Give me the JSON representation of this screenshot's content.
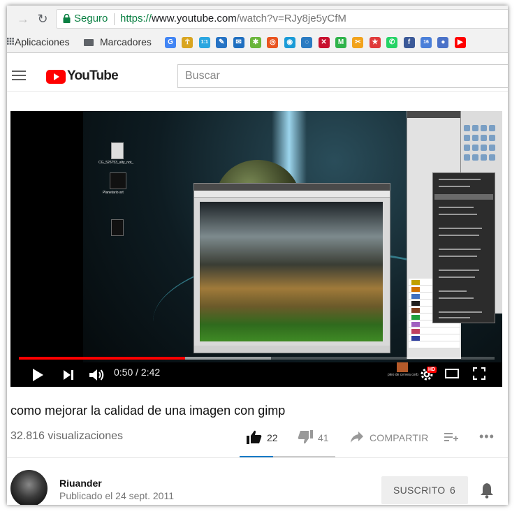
{
  "browser": {
    "secure_label": "Seguro",
    "url_scheme": "https://",
    "url_host": "www.youtube.com",
    "url_path": "/watch?v=RJy8je5yCfM",
    "bookmarks": {
      "apps_label": "Aplicaciones",
      "folder_label": "Marcadores",
      "favicons": [
        {
          "icon": "google-g-icon",
          "glyph": "G",
          "color": "#4285f4"
        },
        {
          "icon": "figure-icon",
          "glyph": "☥",
          "color": "#d9a520"
        },
        {
          "icon": "blue-news-icon",
          "glyph": "1:1",
          "color": "#2aa6e0"
        },
        {
          "icon": "blue-edit-icon",
          "glyph": "✎",
          "color": "#2673c4"
        },
        {
          "icon": "blue-chat-icon",
          "glyph": "✉",
          "color": "#1f6fc0"
        },
        {
          "icon": "green-bug-icon",
          "glyph": "✱",
          "color": "#6ab63b"
        },
        {
          "icon": "ubuntu-icon",
          "glyph": "◎",
          "color": "#e95420"
        },
        {
          "icon": "blue-circle-icon",
          "glyph": "◉",
          "color": "#1a9bd7"
        },
        {
          "icon": "blue-swirl-icon",
          "glyph": "◌",
          "color": "#2b7bc2"
        },
        {
          "icon": "red-x-icon",
          "glyph": "✕",
          "color": "#c8102e"
        },
        {
          "icon": "green-m-icon",
          "glyph": "M",
          "color": "#2fb34a"
        },
        {
          "icon": "orange-share-icon",
          "glyph": "✂",
          "color": "#f2a31c"
        },
        {
          "icon": "red-star-icon",
          "glyph": "★",
          "color": "#e03a3a"
        },
        {
          "icon": "whatsapp-icon",
          "glyph": "✆",
          "color": "#25d366"
        },
        {
          "icon": "facebook-icon",
          "glyph": "f",
          "color": "#3b5998"
        },
        {
          "icon": "calendar-icon",
          "glyph": "16",
          "color": "#4a7fd9"
        },
        {
          "icon": "account-icon",
          "glyph": "●",
          "color": "#4b72c8"
        },
        {
          "icon": "youtube-icon",
          "glyph": "▶",
          "color": "#ff0000"
        }
      ]
    }
  },
  "youtube": {
    "logo_text": "YouTube",
    "search_placeholder": "Buscar"
  },
  "player": {
    "current_time": "0:50",
    "separator": " / ",
    "duration": "2:42",
    "played_fraction": 0.35,
    "buffered_fraction": 0.53,
    "hd_badge": "HD"
  },
  "video": {
    "title": "como mejorar la calidad de una imagen con gimp",
    "views": "32.816 visualizaciones",
    "likes": "22",
    "dislikes": "41",
    "share_label": "COMPARTIR",
    "like_fraction": 0.35
  },
  "channel": {
    "name": "Riuander",
    "published": "Publicado el 24 sept. 2011",
    "subscribe_label": "SUSCRITO",
    "subscriber_count": "6"
  },
  "colors": {
    "secure_green": "#0b8043",
    "youtube_red": "#ff0000",
    "progress_red": "#ff0000",
    "like_blue": "#167ac6"
  }
}
